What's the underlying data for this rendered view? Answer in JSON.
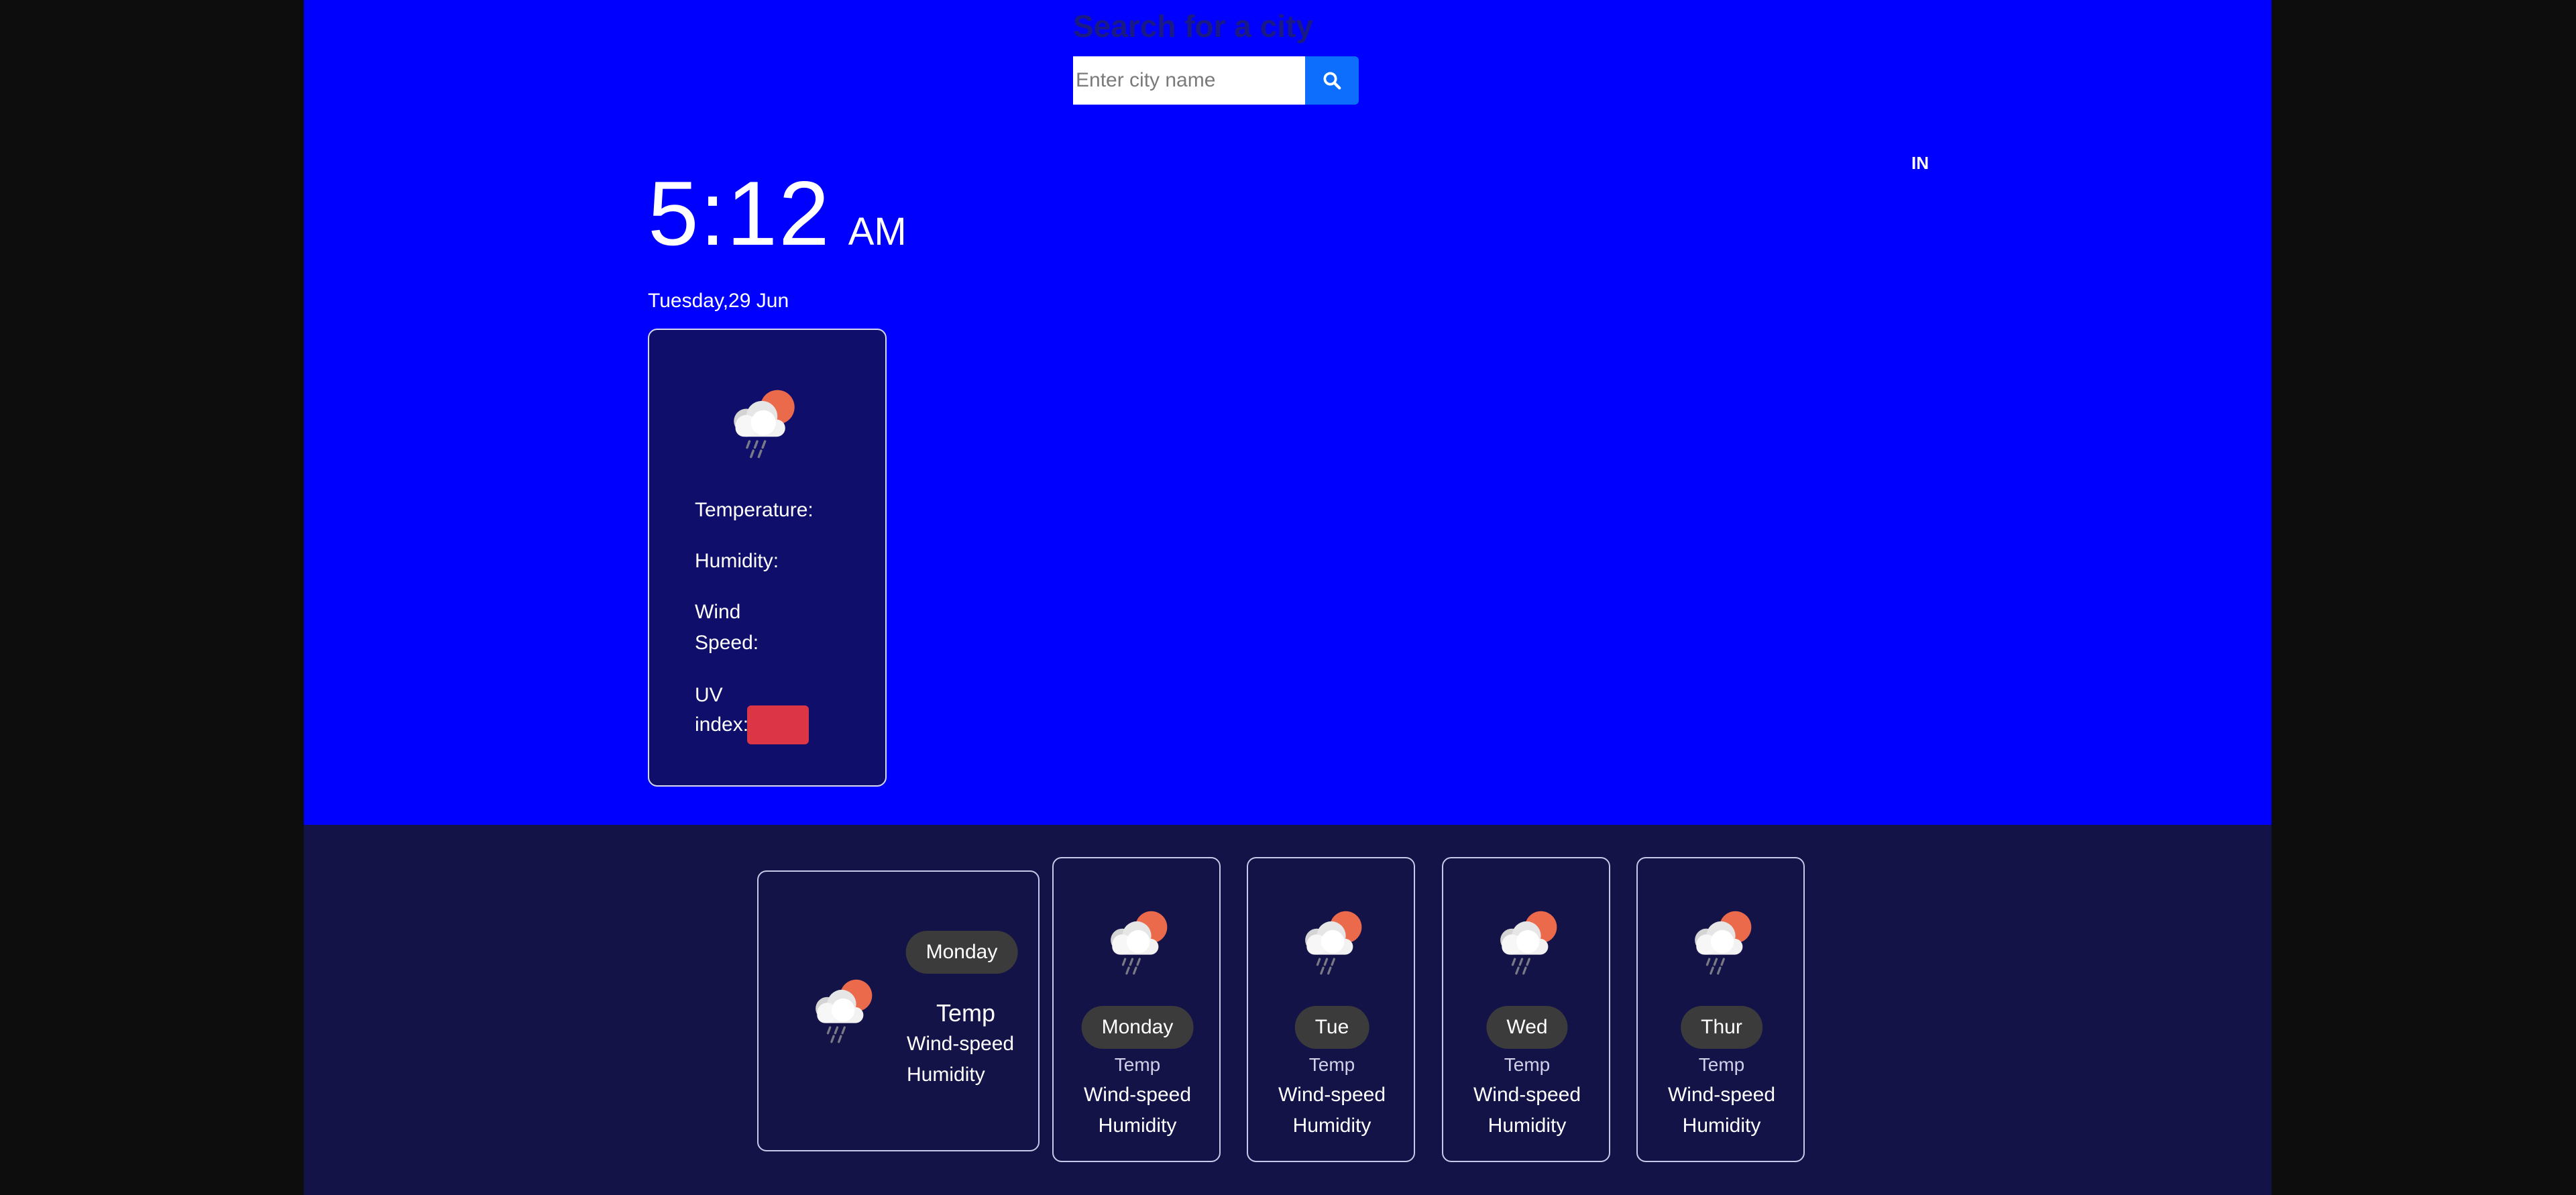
{
  "search": {
    "heading": "Search for a city",
    "placeholder": "Enter city name",
    "button_icon": "search-icon"
  },
  "location": {
    "country": "IN"
  },
  "clock": {
    "time": "5:12",
    "ampm": "AM",
    "date": "Tuesday,29 Jun"
  },
  "current": {
    "icon": "cloud-sun-rain-icon",
    "temperature_label": "Temperature:",
    "humidity_label": "Humidity:",
    "wind_label_line1": "Wind",
    "wind_label_line2": "Speed:",
    "uv_label_line1": "UV",
    "uv_label_line2": "index:",
    "uv_badge_color": "#dc3545"
  },
  "forecast": {
    "featured": {
      "day": "Monday",
      "temp_label": "Temp",
      "wind_label": "Wind-speed",
      "humidity_label": "Humidity",
      "icon": "cloud-sun-rain-icon"
    },
    "days": [
      {
        "day": "Monday",
        "temp_label": "Temp",
        "wind_label": "Wind-speed",
        "humidity_label": "Humidity",
        "icon": "cloud-sun-rain-icon"
      },
      {
        "day": "Tue",
        "temp_label": "Temp",
        "wind_label": "Wind-speed",
        "humidity_label": "Humidity",
        "icon": "cloud-sun-rain-icon"
      },
      {
        "day": "Wed",
        "temp_label": "Temp",
        "wind_label": "Wind-speed",
        "humidity_label": "Humidity",
        "icon": "cloud-sun-rain-icon"
      },
      {
        "day": "Thur",
        "temp_label": "Temp",
        "wind_label": "Wind-speed",
        "humidity_label": "Humidity",
        "icon": "cloud-sun-rain-icon"
      }
    ]
  },
  "colors": {
    "hero_background": "#0000ff",
    "forecast_background": "#131348",
    "card_background": "#0f0f6b",
    "button_primary": "#0d6efd",
    "day_pill": "#3b3b3b",
    "sun": "#ec6a4c",
    "cloud": "#f2f2f2"
  }
}
